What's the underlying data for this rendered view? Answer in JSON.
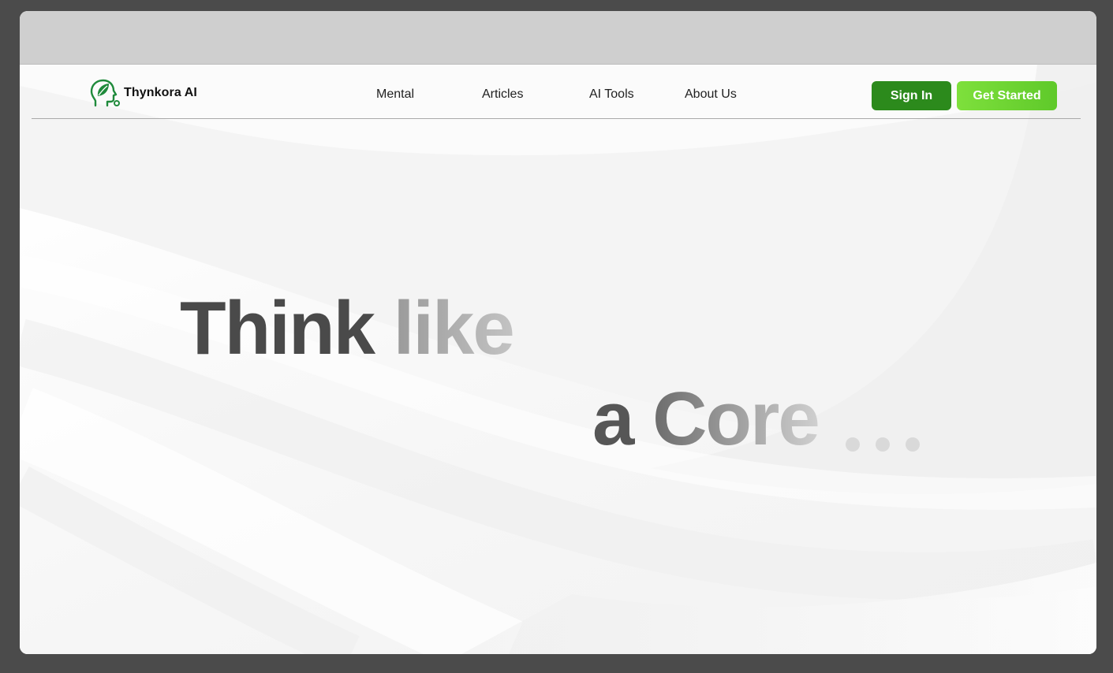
{
  "brand": {
    "name": "Thynkora AI",
    "logo_icon": "head-leaf-icon",
    "accent": "#1f8a3b"
  },
  "nav": {
    "links": [
      {
        "label": "Mental"
      },
      {
        "label": "Articles"
      },
      {
        "label": "AI Tools"
      },
      {
        "label": "About Us"
      }
    ],
    "sign_in_label": "Sign In",
    "get_started_label": "Get Started"
  },
  "hero": {
    "line1_word1": "Think",
    "line1_word2": "like",
    "line2_word1": "a",
    "line2_word2": "Core",
    "loading_dots": 3
  },
  "colors": {
    "sign_in_bg": "#2c8a1c",
    "get_started_bg": "#6fd632",
    "page_bg": "#f6f6f6",
    "frame": "#4b4b4b"
  }
}
